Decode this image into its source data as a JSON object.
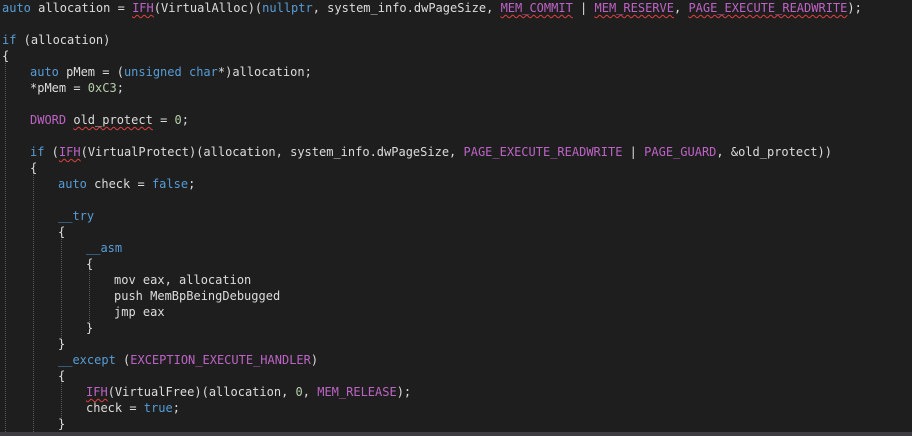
{
  "code": {
    "line1": {
      "a": "auto",
      "b": " allocation = ",
      "c": "IFH",
      "d": "(",
      "e": "VirtualAlloc",
      "f": ")(",
      "g": "nullptr",
      "h": ", system_info.dwPageSize, ",
      "i": "MEM_COMMIT",
      "j": " | ",
      "k": "MEM_RESERVE",
      "l": ", ",
      "m": "PAGE_EXECUTE_READWRITE",
      "n": ");"
    },
    "line3": {
      "a": "if",
      "b": " (allocation)"
    },
    "line4": {
      "a": "{"
    },
    "line5": {
      "a": "auto",
      "b": " pMem = (",
      "c": "unsigned",
      "d": " ",
      "e": "char",
      "f": "*)allocation;"
    },
    "line6": {
      "a": "*pMem = ",
      "b": "0xC3",
      "c": ";"
    },
    "line8": {
      "a": "DWORD",
      "b": " ",
      "c": "old_protect",
      "d": " = ",
      "e": "0",
      "f": ";"
    },
    "line10": {
      "a": "if",
      "b": " (",
      "c": "IFH",
      "d": "(VirtualProtect)(allocation, system_info.dwPageSize, ",
      "e": "PAGE_EXECUTE_READWRITE",
      "f": " | ",
      "g": "PAGE_GUARD",
      "h": ", &old_protect))"
    },
    "line11": {
      "a": "{"
    },
    "line12": {
      "a": "auto",
      "b": " check = ",
      "c": "false",
      "d": ";"
    },
    "line14": {
      "a": "__try"
    },
    "line15": {
      "a": "{"
    },
    "line16": {
      "a": "__asm"
    },
    "line17": {
      "a": "{"
    },
    "line18": {
      "a": "mov eax, allocation"
    },
    "line19": {
      "a": "push MemBpBeingDebugged"
    },
    "line20": {
      "a": "jmp eax"
    },
    "line21": {
      "a": "}"
    },
    "line22": {
      "a": "}"
    },
    "line23": {
      "a": "__except",
      "b": " (",
      "c": "EXCEPTION_EXECUTE_HANDLER",
      "d": ")"
    },
    "line24": {
      "a": "{"
    },
    "line25": {
      "a": "IFH",
      "b": "(VirtualFree)(allocation, ",
      "c": "0",
      "d": ", ",
      "e": "MEM_RELEASE",
      "f": ");"
    },
    "line26": {
      "a": "check = ",
      "b": "true",
      "c": ";"
    },
    "line27": {
      "a": "}"
    }
  },
  "colors": {
    "background": "#1e1e1e",
    "keyword": "#569cd6",
    "function": "#dcdcaa",
    "macro": "#bd63c5",
    "number": "#b5cea8",
    "squiggle": "#e04040"
  }
}
